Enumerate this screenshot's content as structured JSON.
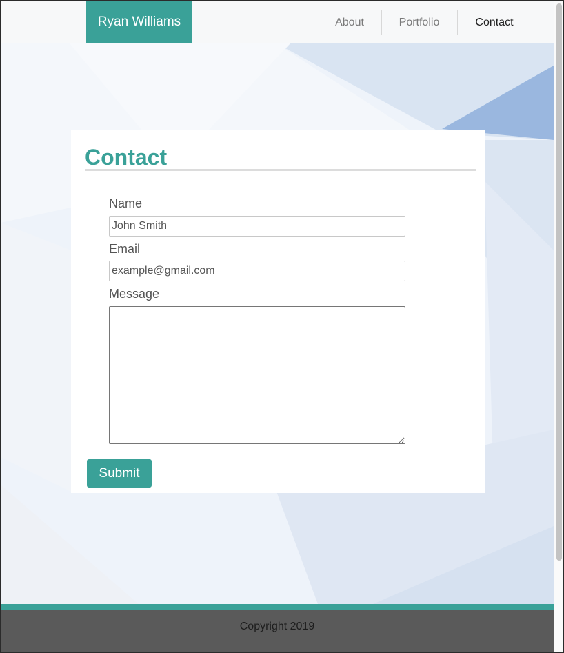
{
  "navbar": {
    "brand": "Ryan Williams",
    "links": [
      {
        "label": "About",
        "active": false
      },
      {
        "label": "Portfolio",
        "active": false
      },
      {
        "label": "Contact",
        "active": true
      }
    ]
  },
  "contact": {
    "title": "Contact",
    "name_label": "Name",
    "name_placeholder": "John Smith",
    "email_label": "Email",
    "email_placeholder": "example@gmail.com",
    "message_label": "Message",
    "submit_label": "Submit"
  },
  "footer": {
    "text": "Copyright 2019"
  },
  "colors": {
    "accent": "#3aa198",
    "footer_bg": "#5a5a5a",
    "navbar_bg": "#f7f8f9",
    "background": "#eef3fa"
  }
}
